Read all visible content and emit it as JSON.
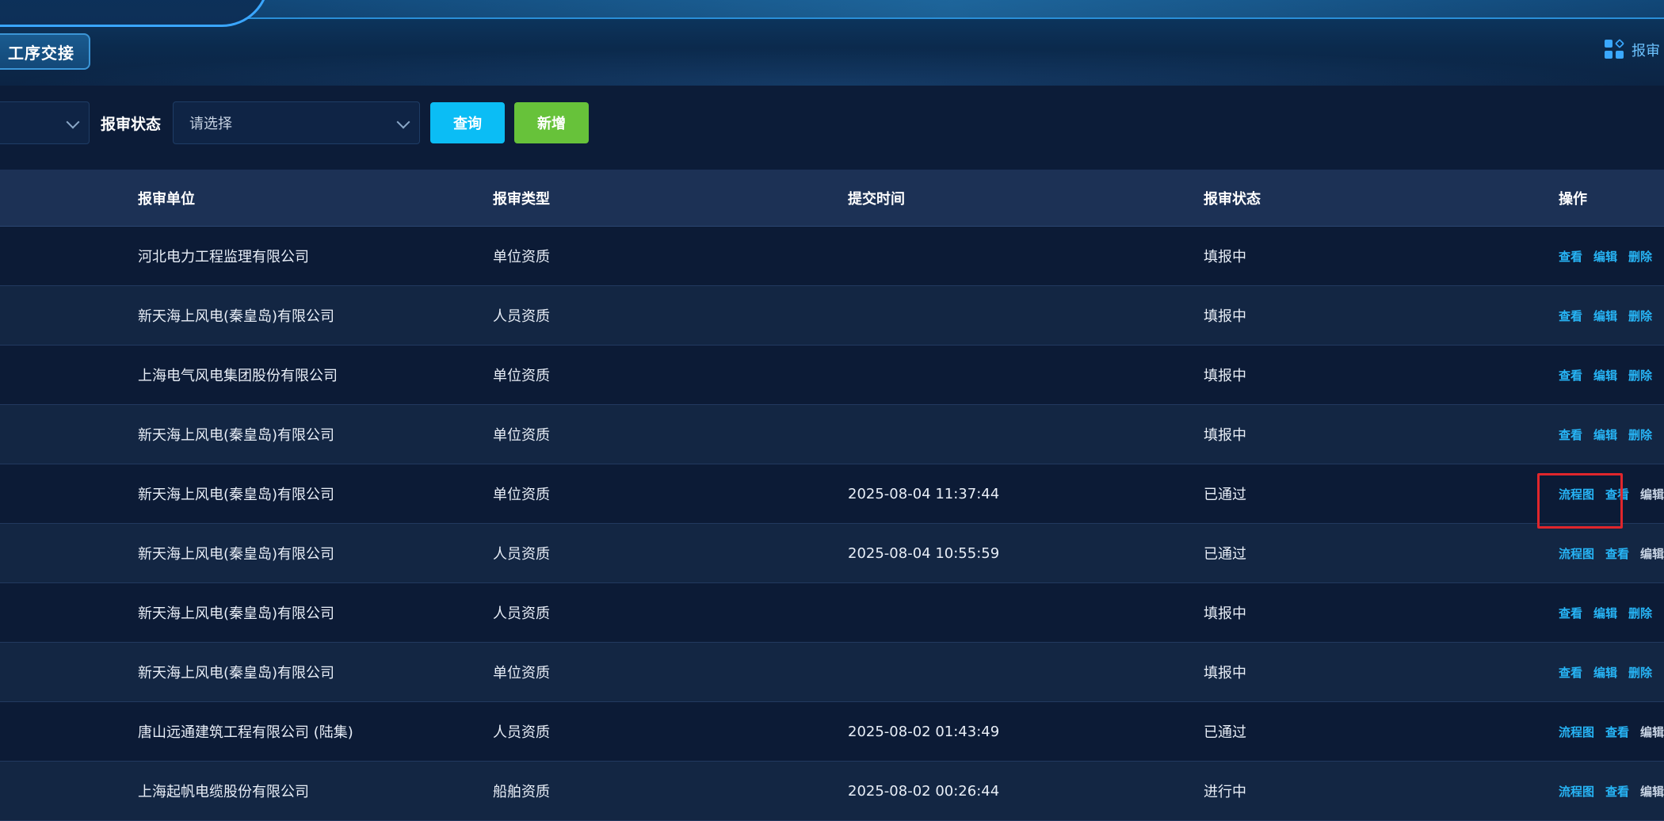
{
  "header": {
    "active_tab": "工序交接",
    "right_link": "报审"
  },
  "filters": {
    "select1": {
      "value": ""
    },
    "status_label": "报审状态",
    "status_select": {
      "placeholder": "请选择"
    },
    "query_label": "查询",
    "add_label": "新增"
  },
  "table": {
    "columns": [
      "报审单位",
      "报审类型",
      "提交时间",
      "报审状态",
      "操作"
    ],
    "rows": [
      {
        "unit": "河北电力工程监理有限公司",
        "type": "单位资质",
        "time": "",
        "status": "填报中",
        "ops": [
          "查看",
          "编辑",
          "删除"
        ]
      },
      {
        "unit": "新天海上风电(秦皇岛)有限公司",
        "type": "人员资质",
        "time": "",
        "status": "填报中",
        "ops": [
          "查看",
          "编辑",
          "删除"
        ]
      },
      {
        "unit": "上海电气风电集团股份有限公司",
        "type": "单位资质",
        "time": "",
        "status": "填报中",
        "ops": [
          "查看",
          "编辑",
          "删除"
        ]
      },
      {
        "unit": "新天海上风电(秦皇岛)有限公司",
        "type": "单位资质",
        "time": "",
        "status": "填报中",
        "ops": [
          "查看",
          "编辑",
          "删除"
        ]
      },
      {
        "unit": "新天海上风电(秦皇岛)有限公司",
        "type": "单位资质",
        "time": "2025-08-04 11:37:44",
        "status": "已通过",
        "ops": [
          "流程图",
          "查看",
          "编辑"
        ]
      },
      {
        "unit": "新天海上风电(秦皇岛)有限公司",
        "type": "人员资质",
        "time": "2025-08-04 10:55:59",
        "status": "已通过",
        "ops": [
          "流程图",
          "查看",
          "编辑"
        ]
      },
      {
        "unit": "新天海上风电(秦皇岛)有限公司",
        "type": "人员资质",
        "time": "",
        "status": "填报中",
        "ops": [
          "查看",
          "编辑",
          "删除"
        ]
      },
      {
        "unit": "新天海上风电(秦皇岛)有限公司",
        "type": "单位资质",
        "time": "",
        "status": "填报中",
        "ops": [
          "查看",
          "编辑",
          "删除"
        ]
      },
      {
        "unit": "唐山远通建筑工程有限公司 (陆集)",
        "type": "人员资质",
        "time": "2025-08-02 01:43:49",
        "status": "已通过",
        "ops": [
          "流程图",
          "查看",
          "编辑"
        ]
      },
      {
        "unit": "上海起帆电缆股份有限公司",
        "type": "船舶资质",
        "time": "2025-08-02 00:26:44",
        "status": "进行中",
        "ops": [
          "流程图",
          "查看",
          "编辑"
        ]
      }
    ]
  },
  "colors": {
    "accent": "#0bbdf5",
    "add": "#67c23a",
    "link": "#27b4f5",
    "highlight": "#e0262c"
  }
}
